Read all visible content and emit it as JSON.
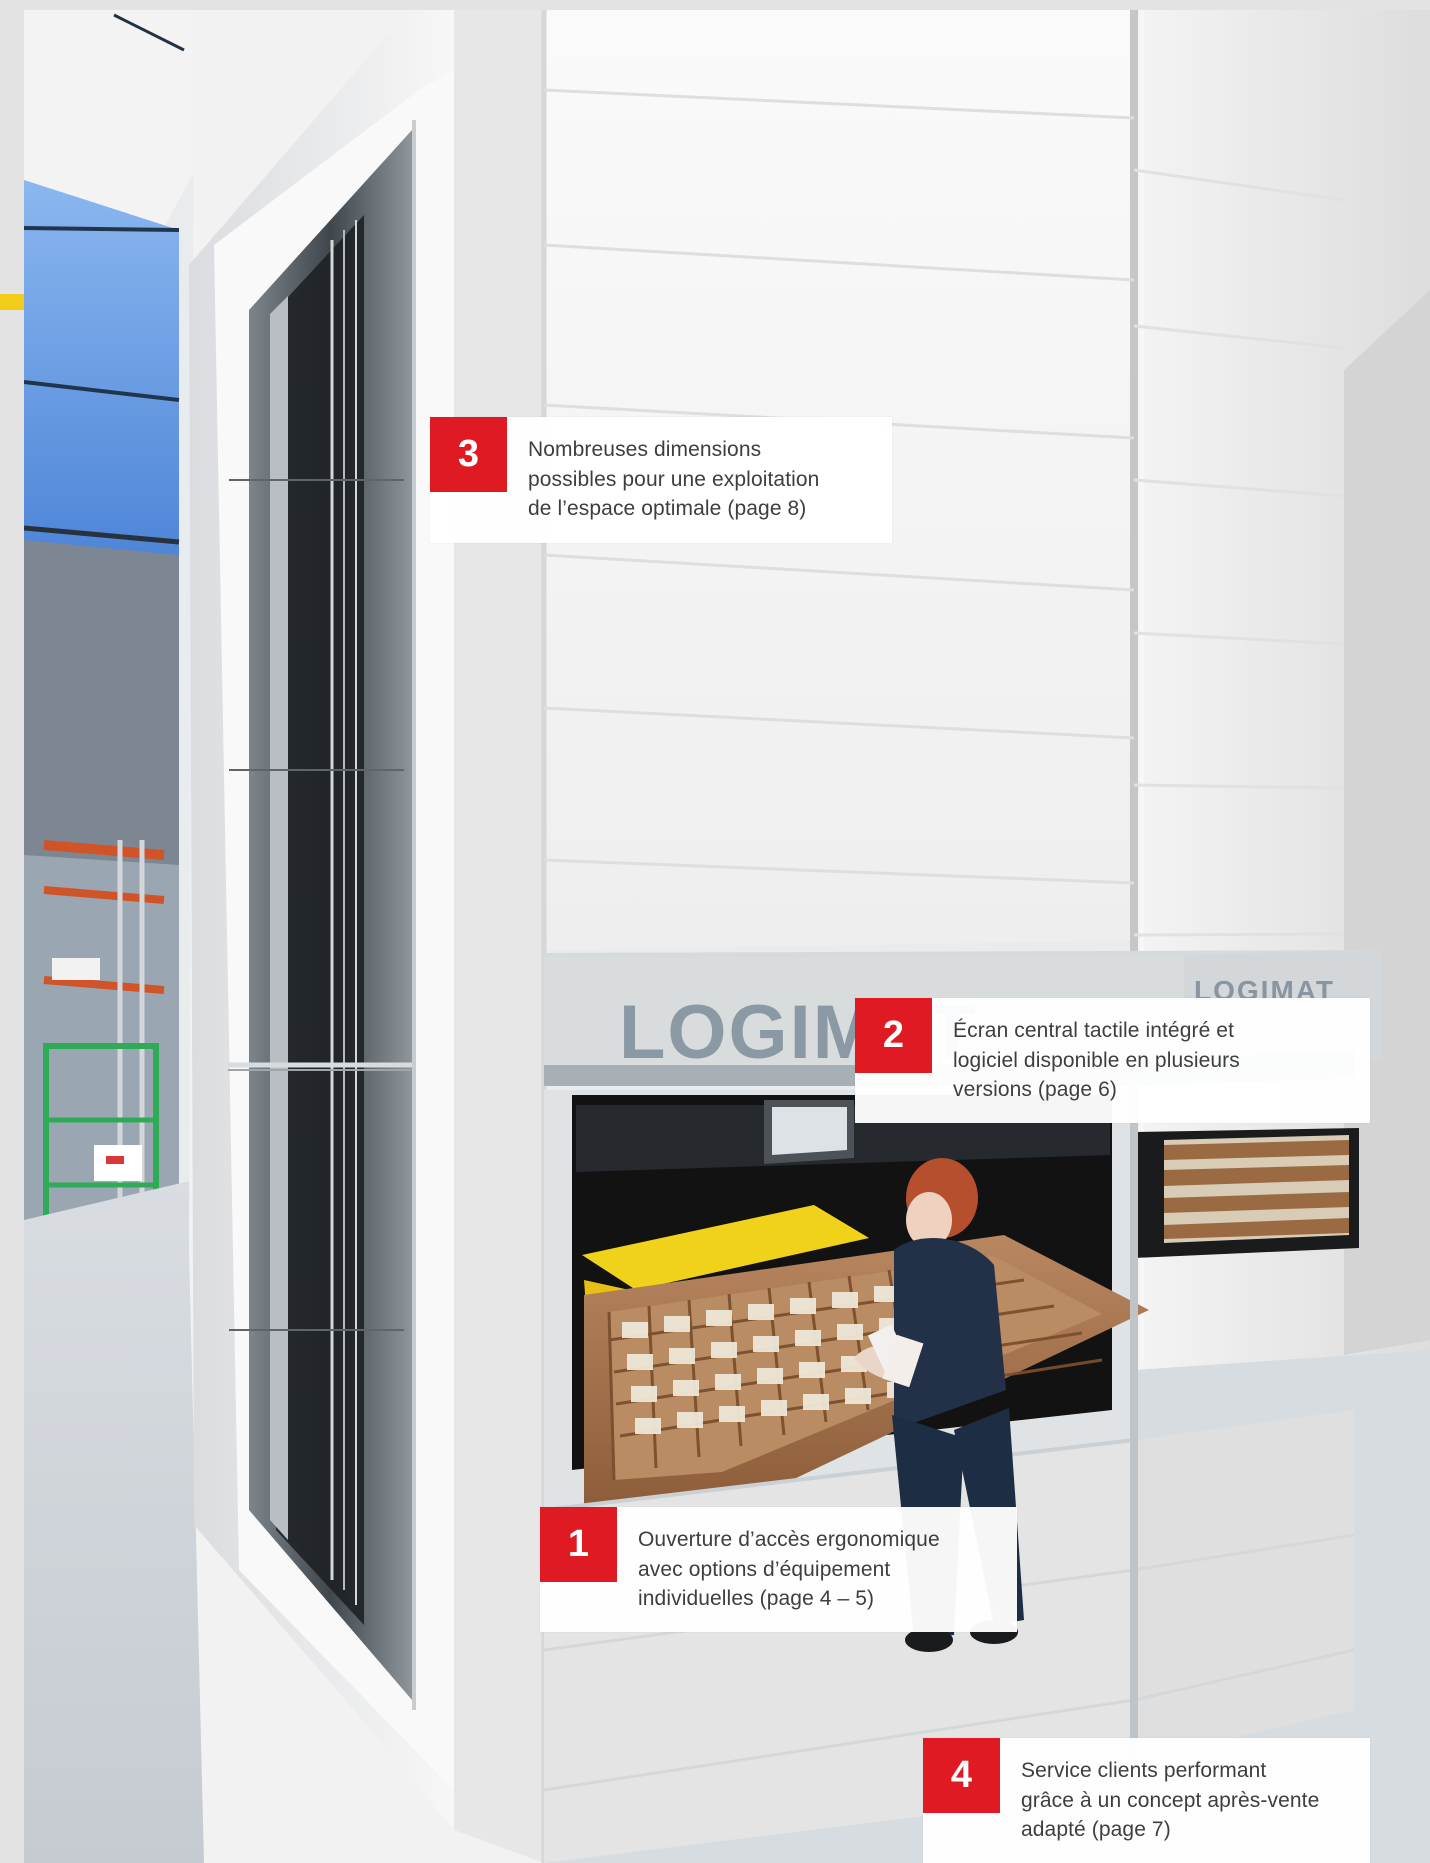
{
  "scene": {
    "logo_main": "LOGIMAT",
    "logo_secondary": "LOGIMAT"
  },
  "callouts": [
    {
      "number": "3",
      "text": "Nombreuses dimensions\npossibles pour une exploitation\nde l’espace optimale (page 8)"
    },
    {
      "number": "2",
      "text": "Écran central tactile intégré et\nlogiciel disponible en plusieurs\nversions (page 6)"
    },
    {
      "number": "1",
      "text": "Ouverture d’accès ergonomique\navec options d’équipement\nindividuelles (page 4 – 5)"
    },
    {
      "number": "4",
      "text": "Service clients performant\ngrâce à un concept après-vente\nadapté (page 7)"
    }
  ],
  "colors": {
    "accent_red": "#df1a22",
    "accent_yellow": "#f2cd18"
  }
}
